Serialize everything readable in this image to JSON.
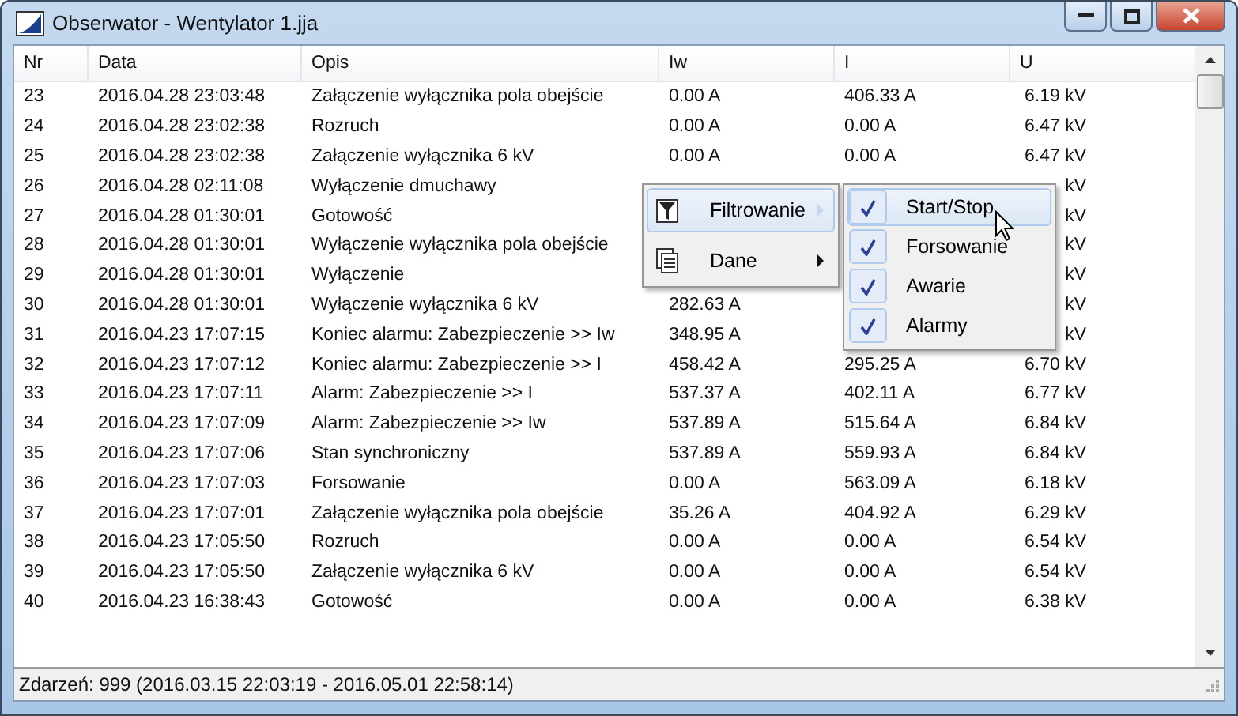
{
  "window": {
    "title": "Obserwator - Wentylator 1.jja"
  },
  "table": {
    "columns": [
      "Nr",
      "Data",
      "Opis",
      "Iw",
      "I",
      "U"
    ],
    "rows": [
      {
        "nr": "23",
        "data": "2016.04.28 23:03:48",
        "opis": "Załączenie wyłącznika pola obejście",
        "iw": "0.00 A",
        "i": "406.33 A",
        "u": "6.19 kV"
      },
      {
        "nr": "24",
        "data": "2016.04.28 23:02:38",
        "opis": "Rozruch",
        "iw": "0.00 A",
        "i": "0.00 A",
        "u": "6.47 kV"
      },
      {
        "nr": "25",
        "data": "2016.04.28 23:02:38",
        "opis": "Załączenie wyłącznika 6 kV",
        "iw": "0.00 A",
        "i": "0.00 A",
        "u": "6.47 kV"
      },
      {
        "nr": "26",
        "data": "2016.04.28 02:11:08",
        "opis": "Wyłączenie dmuchawy",
        "u": "kV"
      },
      {
        "nr": "27",
        "data": "2016.04.28 01:30:01",
        "opis": "Gotowość",
        "u": "kV"
      },
      {
        "nr": "28",
        "data": "2016.04.28 01:30:01",
        "opis": "Wyłączenie wyłącznika pola obejście",
        "u": "kV"
      },
      {
        "nr": "29",
        "data": "2016.04.28 01:30:01",
        "opis": "Wyłączenie",
        "u": "kV"
      },
      {
        "nr": "30",
        "data": "2016.04.28 01:30:01",
        "opis": "Wyłączenie wyłącznika 6 kV",
        "iw": "282.63 A",
        "u": "kV"
      },
      {
        "nr": "31",
        "data": "2016.04.23 17:07:15",
        "opis": "Koniec alarmu:  Zabezpieczenie >> Iw",
        "iw": "348.95 A",
        "u": "kV"
      },
      {
        "nr": "32",
        "data": "2016.04.23 17:07:12",
        "opis": "Koniec alarmu:  Zabezpieczenie >> I",
        "iw": "458.42 A",
        "i": "295.25 A",
        "u": "6.70 kV"
      },
      {
        "nr": "33",
        "data": "2016.04.23 17:07:11",
        "opis": "Alarm:  Zabezpieczenie >> I",
        "iw": "537.37 A",
        "i": "402.11 A",
        "u": "6.77 kV"
      },
      {
        "nr": "34",
        "data": "2016.04.23 17:07:09",
        "opis": "Alarm:  Zabezpieczenie >> Iw",
        "iw": "537.89 A",
        "i": "515.64 A",
        "u": "6.84 kV"
      },
      {
        "nr": "35",
        "data": "2016.04.23 17:07:06",
        "opis": "Stan synchroniczny",
        "iw": "537.89 A",
        "i": "559.93 A",
        "u": "6.84 kV"
      },
      {
        "nr": "36",
        "data": "2016.04.23 17:07:03",
        "opis": "Forsowanie",
        "iw": "0.00 A",
        "i": "563.09 A",
        "u": "6.18 kV"
      },
      {
        "nr": "37",
        "data": "2016.04.23 17:07:01",
        "opis": "Załączenie wyłącznika pola obejście",
        "iw": "35.26 A",
        "i": "404.92 A",
        "u": "6.29 kV"
      },
      {
        "nr": "38",
        "data": "2016.04.23 17:05:50",
        "opis": "Rozruch",
        "iw": "0.00 A",
        "i": "0.00 A",
        "u": "6.54 kV"
      },
      {
        "nr": "39",
        "data": "2016.04.23 17:05:50",
        "opis": "Załączenie wyłącznika 6 kV",
        "iw": "0.00 A",
        "i": "0.00 A",
        "u": "6.54 kV"
      },
      {
        "nr": "40",
        "data": "2016.04.23 16:38:43",
        "opis": "Gotowość",
        "iw": "0.00 A",
        "i": "0.00 A",
        "u": "6.38 kV"
      }
    ]
  },
  "context_menu": {
    "items": [
      {
        "label": "Filtrowanie",
        "kind": "filter",
        "selected": true
      },
      {
        "label": "Dane",
        "kind": "data",
        "selected": false
      }
    ]
  },
  "submenu": {
    "items": [
      {
        "label": "Start/Stop",
        "checked": true,
        "selected": true
      },
      {
        "label": "Forsowanie",
        "checked": true,
        "selected": false
      },
      {
        "label": "Awarie",
        "checked": true,
        "selected": false
      },
      {
        "label": "Alarmy",
        "checked": true,
        "selected": false
      }
    ]
  },
  "status_bar": "Zdarzeń: 999 (2016.03.15 22:03:19 - 2016.05.01 22:58:14)"
}
